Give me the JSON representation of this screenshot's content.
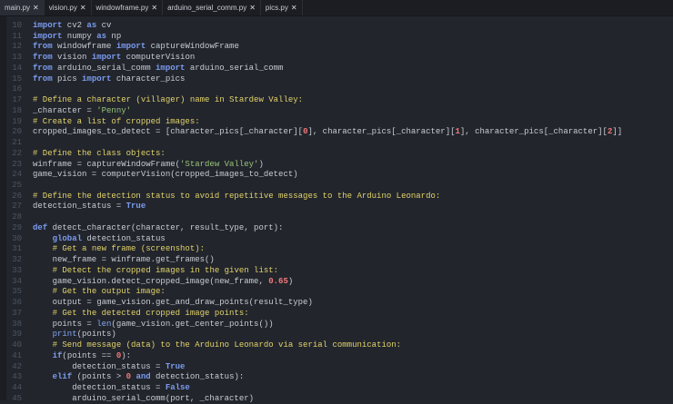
{
  "tabs": [
    {
      "label": "main.py",
      "active": true
    },
    {
      "label": "vision.py",
      "active": false
    },
    {
      "label": "windowframe.py",
      "active": false
    },
    {
      "label": "arduino_serial_comm.py",
      "active": false
    },
    {
      "label": "pics.py",
      "active": false
    }
  ],
  "close_glyph": "✕",
  "colors": {
    "keyword": "#7b9cf0",
    "comment": "#e2d36b",
    "string": "#98c379",
    "number": "#f07878",
    "builtin": "#84a6f2",
    "text": "#c8ccd4",
    "background": "#22252c"
  },
  "lines": [
    {
      "n": "10",
      "t": [
        [
          "kw",
          "import"
        ],
        [
          "tx",
          " cv2 "
        ],
        [
          "kw",
          "as"
        ],
        [
          "tx",
          " cv"
        ]
      ]
    },
    {
      "n": "11",
      "t": [
        [
          "kw",
          "import"
        ],
        [
          "tx",
          " numpy "
        ],
        [
          "kw",
          "as"
        ],
        [
          "tx",
          " np"
        ]
      ]
    },
    {
      "n": "12",
      "t": [
        [
          "kw",
          "from"
        ],
        [
          "tx",
          " windowframe "
        ],
        [
          "kw",
          "import"
        ],
        [
          "tx",
          " captureWindowFrame"
        ]
      ]
    },
    {
      "n": "13",
      "t": [
        [
          "kw",
          "from"
        ],
        [
          "tx",
          " vision "
        ],
        [
          "kw",
          "import"
        ],
        [
          "tx",
          " computerVision"
        ]
      ]
    },
    {
      "n": "14",
      "t": [
        [
          "kw",
          "from"
        ],
        [
          "tx",
          " arduino_serial_comm "
        ],
        [
          "kw",
          "import"
        ],
        [
          "tx",
          " arduino_serial_comm"
        ]
      ]
    },
    {
      "n": "15",
      "t": [
        [
          "kw",
          "from"
        ],
        [
          "tx",
          " pics "
        ],
        [
          "kw",
          "import"
        ],
        [
          "tx",
          " character_pics"
        ]
      ]
    },
    {
      "n": "16",
      "t": []
    },
    {
      "n": "17",
      "t": [
        [
          "cm",
          "# Define a character (villager) name in Stardew Valley:"
        ]
      ]
    },
    {
      "n": "18",
      "t": [
        [
          "tx",
          "_character = "
        ],
        [
          "st",
          "'Penny'"
        ]
      ]
    },
    {
      "n": "19",
      "t": [
        [
          "cm",
          "# Create a list of cropped images:"
        ]
      ]
    },
    {
      "n": "20",
      "t": [
        [
          "tx",
          "cropped_images_to_detect = [character_pics[_character]["
        ],
        [
          "nu",
          "0"
        ],
        [
          "tx",
          "], character_pics[_character]["
        ],
        [
          "nu",
          "1"
        ],
        [
          "tx",
          "], character_pics[_character]["
        ],
        [
          "nu",
          "2"
        ],
        [
          "tx",
          "]]"
        ]
      ]
    },
    {
      "n": "21",
      "t": []
    },
    {
      "n": "22",
      "t": [
        [
          "cm",
          "# Define the class objects:"
        ]
      ]
    },
    {
      "n": "23",
      "t": [
        [
          "tx",
          "winframe = captureWindowFrame("
        ],
        [
          "st",
          "'Stardew Valley'"
        ],
        [
          "tx",
          ")"
        ]
      ]
    },
    {
      "n": "24",
      "t": [
        [
          "tx",
          "game_vision = computerVision(cropped_images_to_detect)"
        ]
      ]
    },
    {
      "n": "25",
      "t": []
    },
    {
      "n": "26",
      "t": [
        [
          "cm",
          "# Define the detection status to avoid repetitive messages to the Arduino Leonardo:"
        ]
      ]
    },
    {
      "n": "27",
      "t": [
        [
          "tx",
          "detection_status = "
        ],
        [
          "kw",
          "True"
        ]
      ]
    },
    {
      "n": "28",
      "t": []
    },
    {
      "n": "29",
      "t": [
        [
          "kw",
          "def"
        ],
        [
          "tx",
          " detect_character(character, result_type, port):"
        ]
      ]
    },
    {
      "n": "30",
      "t": [
        [
          "tx",
          "    "
        ],
        [
          "kw",
          "global"
        ],
        [
          "tx",
          " detection_status"
        ]
      ]
    },
    {
      "n": "31",
      "t": [
        [
          "tx",
          "    "
        ],
        [
          "cm",
          "# Get a new frame (screenshot):"
        ]
      ]
    },
    {
      "n": "32",
      "t": [
        [
          "tx",
          "    new_frame = winframe.get_frames()"
        ]
      ]
    },
    {
      "n": "33",
      "t": [
        [
          "tx",
          "    "
        ],
        [
          "cm",
          "# Detect the cropped images in the given list:"
        ]
      ]
    },
    {
      "n": "34",
      "t": [
        [
          "tx",
          "    game_vision.detect_cropped_image(new_frame, "
        ],
        [
          "nu",
          "0.65"
        ],
        [
          "tx",
          ")"
        ]
      ]
    },
    {
      "n": "35",
      "t": [
        [
          "tx",
          "    "
        ],
        [
          "cm",
          "# Get the output image:"
        ]
      ]
    },
    {
      "n": "36",
      "t": [
        [
          "tx",
          "    output = game_vision.get_and_draw_points(result_type)"
        ]
      ]
    },
    {
      "n": "37",
      "t": [
        [
          "tx",
          "    "
        ],
        [
          "cm",
          "# Get the detected cropped image points:"
        ]
      ]
    },
    {
      "n": "38",
      "t": [
        [
          "tx",
          "    points = "
        ],
        [
          "bi",
          "len"
        ],
        [
          "tx",
          "(game_vision.get_center_points())"
        ]
      ]
    },
    {
      "n": "39",
      "t": [
        [
          "tx",
          "    "
        ],
        [
          "bi",
          "print"
        ],
        [
          "tx",
          "(points)"
        ]
      ]
    },
    {
      "n": "40",
      "t": [
        [
          "tx",
          "    "
        ],
        [
          "cm",
          "# Send message (data) to the Arduino Leonardo via serial communication:"
        ]
      ]
    },
    {
      "n": "41",
      "t": [
        [
          "tx",
          "    "
        ],
        [
          "kw",
          "if"
        ],
        [
          "tx",
          "(points == "
        ],
        [
          "nu",
          "0"
        ],
        [
          "tx",
          "):"
        ]
      ]
    },
    {
      "n": "42",
      "t": [
        [
          "tx",
          "        detection_status = "
        ],
        [
          "kw",
          "True"
        ]
      ]
    },
    {
      "n": "43",
      "t": [
        [
          "tx",
          "    "
        ],
        [
          "kw",
          "elif"
        ],
        [
          "tx",
          " (points > "
        ],
        [
          "nu",
          "0"
        ],
        [
          "tx",
          " "
        ],
        [
          "kw",
          "and"
        ],
        [
          "tx",
          " detection_status):"
        ]
      ]
    },
    {
      "n": "44",
      "t": [
        [
          "tx",
          "        detection_status = "
        ],
        [
          "kw",
          "False"
        ]
      ]
    },
    {
      "n": "45",
      "t": [
        [
          "tx",
          "        arduino_serial_comm(port, _character)"
        ]
      ]
    }
  ]
}
